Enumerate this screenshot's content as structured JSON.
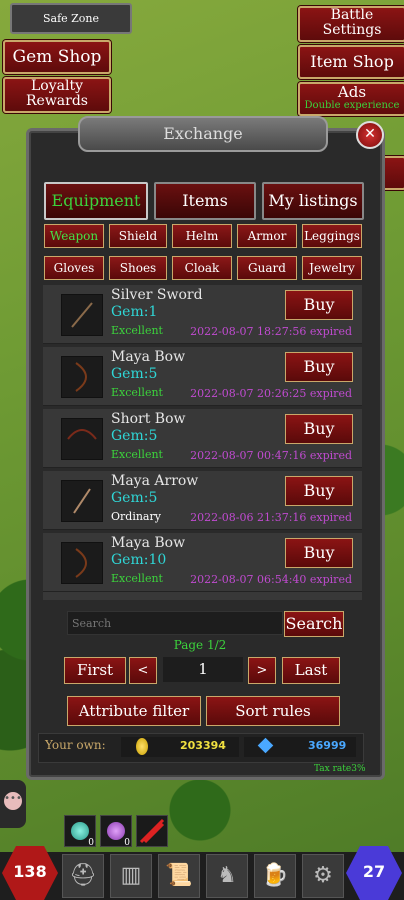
{
  "hud": {
    "safe_zone": "Safe Zone",
    "gem_shop": "Gem Shop",
    "loyalty_rewards": "Loyalty Rewards",
    "battle_settings": "Battle Settings",
    "item_shop": "Item Shop",
    "ads": "Ads",
    "ads_sub": "Double experience"
  },
  "dialog": {
    "title": "Exchange",
    "tabs": [
      "Equipment",
      "Items",
      "My listings"
    ],
    "categories_row1": [
      "Weapon",
      "Shield",
      "Helm",
      "Armor",
      "Leggings"
    ],
    "categories_row2": [
      "Gloves",
      "Shoes",
      "Cloak",
      "Guard",
      "Jewelry"
    ],
    "listings": [
      {
        "name": "Silver Sword",
        "gem": "Gem:1",
        "quality": "Excellent",
        "expiry": "2022-08-07 18:27:56 expired",
        "buy": "Buy"
      },
      {
        "name": "Maya Bow",
        "gem": "Gem:5",
        "quality": "Excellent",
        "expiry": "2022-08-07 20:26:25 expired",
        "buy": "Buy"
      },
      {
        "name": "Short Bow",
        "gem": "Gem:5",
        "quality": "Excellent",
        "expiry": "2022-08-07 00:47:16 expired",
        "buy": "Buy"
      },
      {
        "name": "Maya Arrow",
        "gem": "Gem:5",
        "quality": "Ordinary",
        "expiry": "2022-08-06 21:37:16 expired",
        "buy": "Buy"
      },
      {
        "name": "Maya Bow",
        "gem": "Gem:10",
        "quality": "Excellent",
        "expiry": "2022-08-07 06:54:40 expired",
        "buy": "Buy"
      }
    ],
    "search_placeholder": "Search",
    "search_button": "Search",
    "page_label": "Page 1/2",
    "first": "First",
    "prev": "<",
    "page_value": "1",
    "next": ">",
    "last": "Last",
    "attribute_filter": "Attribute filter",
    "sort_rules": "Sort rules",
    "your_own": "Your own:",
    "gold": "203394",
    "gems": "36999",
    "tax_rate": "Tax rate3%"
  },
  "bottom": {
    "level_left": "138",
    "level_right": "27",
    "potion_count_1": "0",
    "potion_count_2": "0"
  },
  "colors": {
    "active_text": "#3cd23c",
    "gem_text": "#2fd6d6",
    "expiry_text": "#c04bd0",
    "button_red": "#8b1414"
  }
}
